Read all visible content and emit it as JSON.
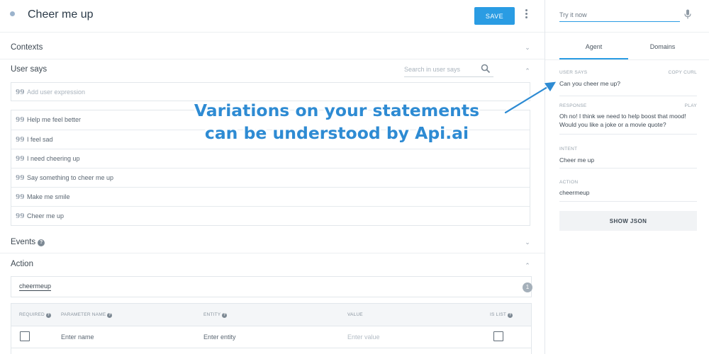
{
  "header": {
    "title": "Cheer me up",
    "save_label": "SAVE"
  },
  "sections": {
    "contexts": "Contexts",
    "user_says": "User says",
    "events": "Events",
    "action": "Action"
  },
  "user_says": {
    "search_placeholder": "Search in user says",
    "add_placeholder": "Add user expression",
    "expressions": [
      "Help me feel better",
      "I feel sad",
      "I need cheering up",
      "Say something to cheer me up",
      "Make me smile",
      "Cheer me up"
    ]
  },
  "action": {
    "value": "cheermeup",
    "badge": "1"
  },
  "parameters": {
    "columns": {
      "required": "REQUIRED",
      "name": "PARAMETER NAME",
      "entity": "ENTITY",
      "value": "VALUE",
      "is_list": "IS LIST"
    },
    "row": {
      "name_placeholder": "Enter name",
      "entity_placeholder": "Enter entity",
      "value_placeholder": "Enter value"
    }
  },
  "right_panel": {
    "try_placeholder": "Try it now",
    "tabs": [
      "Agent",
      "Domains"
    ],
    "active_tab": "Agent",
    "user_says_label": "USER SAYS",
    "copy_curl": "COPY CURL",
    "user_says_value": "Can you cheer me up?",
    "response_label": "RESPONSE",
    "play": "PLAY",
    "response_value": "Oh no! I think we need to help boost that mood! Would you like a joke or a movie quote?",
    "intent_label": "INTENT",
    "intent_value": "Cheer me up",
    "action_label": "ACTION",
    "action_value": "cheermeup",
    "show_json": "SHOW JSON"
  },
  "callout": {
    "line1": "Variations on your statements",
    "line2": "can be understood by Api.ai"
  },
  "colors": {
    "accent": "#2a9ce3",
    "callout": "#2e8bd3"
  },
  "icons": [
    "intent-dot-icon",
    "more-vert-icon",
    "chevron-down-icon",
    "chevron-up-icon",
    "search-icon",
    "quote-icon",
    "help-icon",
    "microphone-icon",
    "arrow-icon"
  ]
}
